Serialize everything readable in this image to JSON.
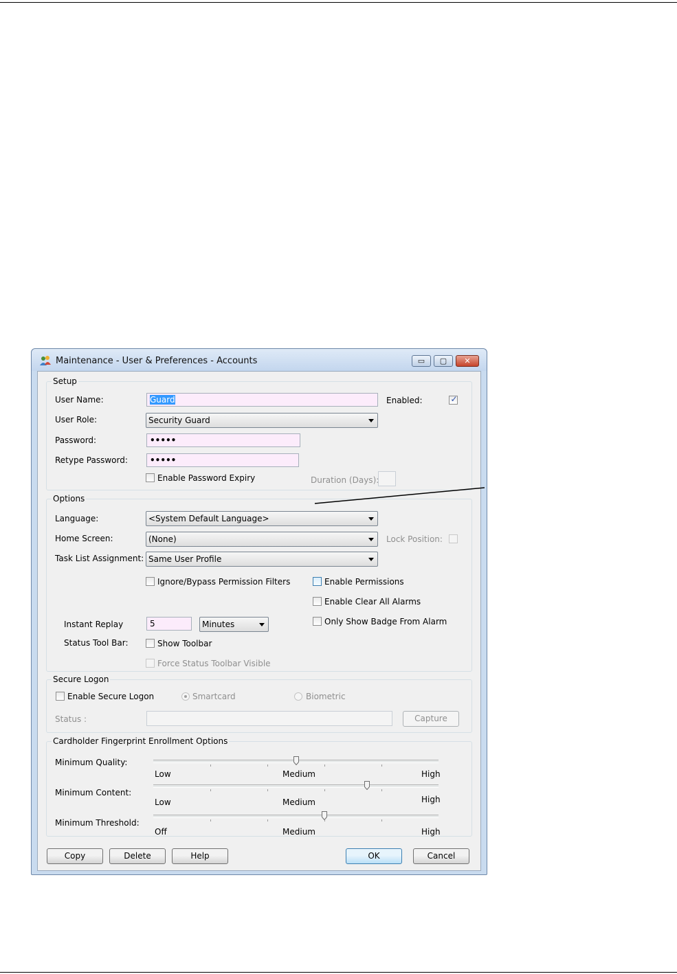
{
  "window": {
    "title": "Maintenance - User & Preferences - Accounts",
    "buttons": {
      "minimize": "▭",
      "maximize": "▢",
      "close": "✕"
    }
  },
  "setup": {
    "group_label": "Setup",
    "user_name_label": "User Name:",
    "user_name_value": "Guard",
    "enabled_label": "Enabled:",
    "enabled_checked": true,
    "user_role_label": "User Role:",
    "user_role_value": "Security Guard",
    "password_label": "Password:",
    "password_value": "•••••",
    "retype_password_label": "Retype Password:",
    "retype_password_value": "•••••",
    "enable_password_expiry_label": "Enable Password Expiry",
    "duration_label": "Duration (Days):",
    "duration_value": ""
  },
  "options": {
    "group_label": "Options",
    "language_label": "Language:",
    "language_value": "<System Default Language>",
    "home_screen_label": "Home Screen:",
    "home_screen_value": "(None)",
    "lock_position_label": "Lock Position:",
    "task_list_label": "Task List Assignment:",
    "task_list_value": "Same User Profile",
    "ignore_bypass_label": "Ignore/Bypass Permission Filters",
    "enable_permissions_label": "Enable Permissions",
    "enable_clear_alarms_label": "Enable Clear All Alarms",
    "only_show_badge_label": "Only Show Badge From Alarm",
    "instant_replay_label": "Instant Replay",
    "instant_replay_value": "5",
    "instant_replay_unit": "Minutes",
    "status_toolbar_label": "Status Tool Bar:",
    "show_toolbar_label": "Show Toolbar",
    "force_status_label": "Force Status Toolbar Visible"
  },
  "secure_logon": {
    "group_label": "Secure Logon",
    "enable_label": "Enable Secure Logon",
    "smartcard_label": "Smartcard",
    "biometric_label": "Biometric",
    "status_label": "Status :",
    "status_value": "",
    "capture_label": "Capture"
  },
  "fingerprint": {
    "group_label": "Cardholder Fingerprint Enrollment Options",
    "sliders": [
      {
        "label": "Minimum Quality:",
        "low": "Low",
        "mid": "Medium",
        "high": "High",
        "level": 0.5
      },
      {
        "label": "Minimum Content:",
        "low": "Low",
        "mid": "Medium",
        "high": "High",
        "level": 0.75
      },
      {
        "label": "Minimum Threshold:",
        "low": "Off",
        "mid": "Medium",
        "high": "High",
        "level": 0.6
      }
    ]
  },
  "footer": {
    "copy": "Copy",
    "delete": "Delete",
    "help": "Help",
    "ok": "OK",
    "cancel": "Cancel"
  }
}
